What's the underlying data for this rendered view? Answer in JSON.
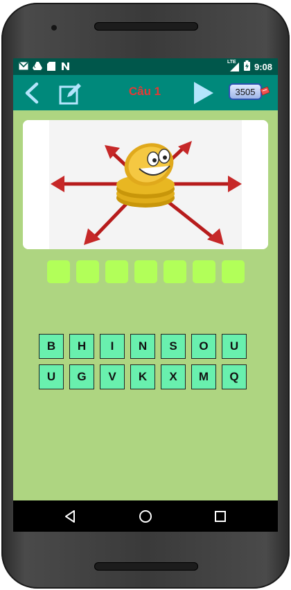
{
  "statusbar": {
    "time": "9:08",
    "network_label": "LTE",
    "left_icons": [
      "gmail-icon",
      "drive-icon",
      "sd-card-icon",
      "n-app-icon"
    ]
  },
  "appbar": {
    "title": "Câu 1",
    "coins": "3505",
    "icons": [
      "back-icon",
      "edit-icon",
      "play-icon",
      "ticket-icon"
    ]
  },
  "puzzle": {
    "image_desc_icon": "coin-stack-with-arrows",
    "answer_slots": 7
  },
  "keyboard": {
    "row1": [
      "B",
      "H",
      "I",
      "N",
      "S",
      "O",
      "U"
    ],
    "row2": [
      "U",
      "G",
      "V",
      "K",
      "X",
      "M",
      "Q"
    ]
  },
  "colors": {
    "statusbar_bg": "#00574b",
    "appbar_bg": "#00897b",
    "content_bg": "#aed581",
    "slot": "#b2ff59",
    "key": "#69f0ae",
    "title": "#e53935"
  }
}
